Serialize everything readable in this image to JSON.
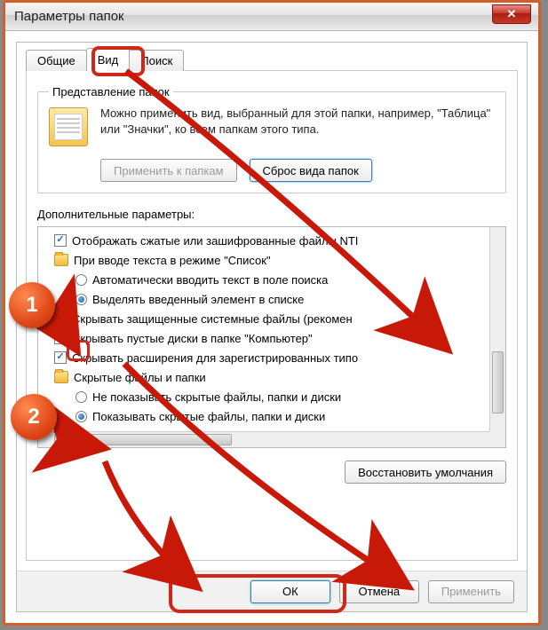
{
  "window": {
    "title": "Параметры папок",
    "close": "✕"
  },
  "tabs": {
    "general": "Общие",
    "view": "Вид",
    "search": "Поиск"
  },
  "folderViews": {
    "legend": "Представление папок",
    "desc": "Можно применить вид, выбранный для этой папки, например, \"Таблица\" или \"Значки\", ко всем папкам этого типа.",
    "applyBtn": "Применить к папкам",
    "resetBtn": "Сброс вида папок"
  },
  "advanced": {
    "label": "Дополнительные параметры:",
    "items": {
      "compressed": "Отображать сжатые или зашифрованные файлы NTI",
      "typingGroup": "При вводе текста в режиме \"Список\"",
      "typingAuto": "Автоматически вводить текст в поле поиска",
      "typingSelect": "Выделять введенный элемент в списке",
      "hideProtected": "Скрывать защищенные системные файлы (рекомен",
      "hideEmpty": "Скрывать пустые диски в папке \"Компьютер\"",
      "hideExt": "Скрывать расширения для зарегистрированных типо",
      "hiddenGroup": "Скрытые файлы и папки",
      "dontShow": "Не показывать скрытые файлы, папки и диски",
      "showHidden": "Показывать скрытые файлы, папки и диски"
    }
  },
  "buttons": {
    "restore": "Восстановить умолчания",
    "ok": "ОК",
    "cancel": "Отмена",
    "apply": "Применить"
  },
  "callouts": {
    "one": "1",
    "two": "2"
  }
}
